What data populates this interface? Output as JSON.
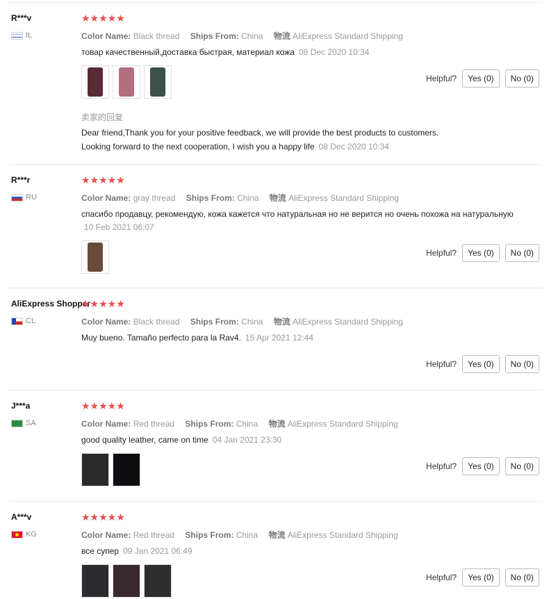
{
  "labels": {
    "color_name": "Color Name:",
    "ships_from": "Ships From:",
    "shipping_label": "物流",
    "helpful": "Helpful?",
    "reply_title": "卖家的回复"
  },
  "reviews": [
    {
      "user": "R***v",
      "country": "IL",
      "stars": "★★★★★",
      "color": "Black thread",
      "ships_from": "China",
      "shipping": "AliExpress Standard Shipping",
      "text": "товар качественный,доставка быстрая, материал кожа",
      "date": "08 Dec 2020 10:34",
      "yes": "Yes (0)",
      "no": "No (0)",
      "reply_text": "Dear friend,Thank you for your positive feedback, we will provide the best products to customers. Looking forward to the next cooperation, I wish you a happy life",
      "reply_date": "08 Dec 2020 10:34",
      "thumb_colors": [
        "#5a2a35",
        "#b07080",
        "#3a5048"
      ]
    },
    {
      "user": "R***r",
      "country": "RU",
      "stars": "★★★★★",
      "color": "gray thread",
      "ships_from": "China",
      "shipping": "AliExpress Standard Shipping",
      "text": "спасибо продавцу, рекомендую, кожа кажется что натуральная но не верится но очень похожа на натуральную",
      "date": "10 Feb 2021 06:07",
      "yes": "Yes (0)",
      "no": "No (0)",
      "thumb_colors": [
        "#6a4a3a"
      ]
    },
    {
      "user": "AliExpress Shopper",
      "country": "CL",
      "stars": "★★★★★",
      "color": "Black thread",
      "ships_from": "China",
      "shipping": "AliExpress Standard Shipping",
      "text": "Muy bueno. Tamaño perfecto para la Rav4.",
      "date": "15 Apr 2021 12:44",
      "yes": "Yes (0)",
      "no": "No (0)"
    },
    {
      "user": "J***a",
      "country": "SA",
      "stars": "★★★★★",
      "color": "Red thread",
      "ships_from": "China",
      "shipping": "AliExpress Standard Shipping",
      "text": "good quality leather, came on time",
      "date": "04 Jan 2021 23:30",
      "yes": "Yes (0)",
      "no": "No (0)",
      "thumb_colors": [
        "#2a2a2a",
        "#0e0e12"
      ]
    },
    {
      "user": "A***v",
      "country": "KG",
      "stars": "★★★★★",
      "color": "Red thread",
      "ships_from": "China",
      "shipping": "AliExpress Standard Shipping",
      "text": "все супер",
      "date": "09 Jan 2021 06:49",
      "yes": "Yes (0)",
      "no": "No (0)",
      "thumb_colors": [
        "#2b2b30",
        "#3a2a30",
        "#2e2e2e"
      ]
    }
  ]
}
